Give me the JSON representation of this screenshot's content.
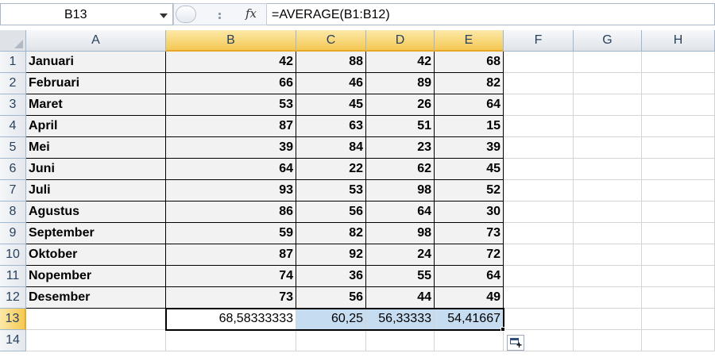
{
  "name_box": {
    "value": "B13"
  },
  "formula_bar": {
    "fx_label": "fx",
    "formula": "=AVERAGE(B1:B12)"
  },
  "columns": [
    "A",
    "B",
    "C",
    "D",
    "E",
    "F",
    "G",
    "H"
  ],
  "row_numbers": [
    "1",
    "2",
    "3",
    "4",
    "5",
    "6",
    "7",
    "8",
    "9",
    "10",
    "11",
    "12",
    "13",
    "14"
  ],
  "selected_cell": "B13",
  "rows": [
    {
      "month": "Januari",
      "b": "42",
      "c": "88",
      "d": "42",
      "e": "68"
    },
    {
      "month": "Februari",
      "b": "66",
      "c": "46",
      "d": "89",
      "e": "82"
    },
    {
      "month": "Maret",
      "b": "53",
      "c": "45",
      "d": "26",
      "e": "64"
    },
    {
      "month": "April",
      "b": "87",
      "c": "63",
      "d": "51",
      "e": "15"
    },
    {
      "month": "Mei",
      "b": "39",
      "c": "84",
      "d": "23",
      "e": "39"
    },
    {
      "month": "Juni",
      "b": "64",
      "c": "22",
      "d": "62",
      "e": "45"
    },
    {
      "month": "Juli",
      "b": "93",
      "c": "53",
      "d": "98",
      "e": "52"
    },
    {
      "month": "Agustus",
      "b": "86",
      "c": "56",
      "d": "64",
      "e": "30"
    },
    {
      "month": "September",
      "b": "59",
      "c": "82",
      "d": "98",
      "e": "73"
    },
    {
      "month": "Oktober",
      "b": "87",
      "c": "92",
      "d": "24",
      "e": "72"
    },
    {
      "month": "Nopember",
      "b": "74",
      "c": "36",
      "d": "55",
      "e": "64"
    },
    {
      "month": "Desember",
      "b": "73",
      "c": "56",
      "d": "44",
      "e": "49"
    }
  ],
  "averages": {
    "b": "68,58333333",
    "c": "60,25",
    "d": "56,33333",
    "e": "54,41667"
  },
  "icons": {
    "namebox_dropdown": "chevron-down-icon",
    "fx": "function-icon",
    "autofill": "auto-fill-options-icon"
  },
  "colors": {
    "selected_header": "#f5c853",
    "filled_highlight": "#c6dcf0",
    "table_fill": "#f2f2f2"
  }
}
